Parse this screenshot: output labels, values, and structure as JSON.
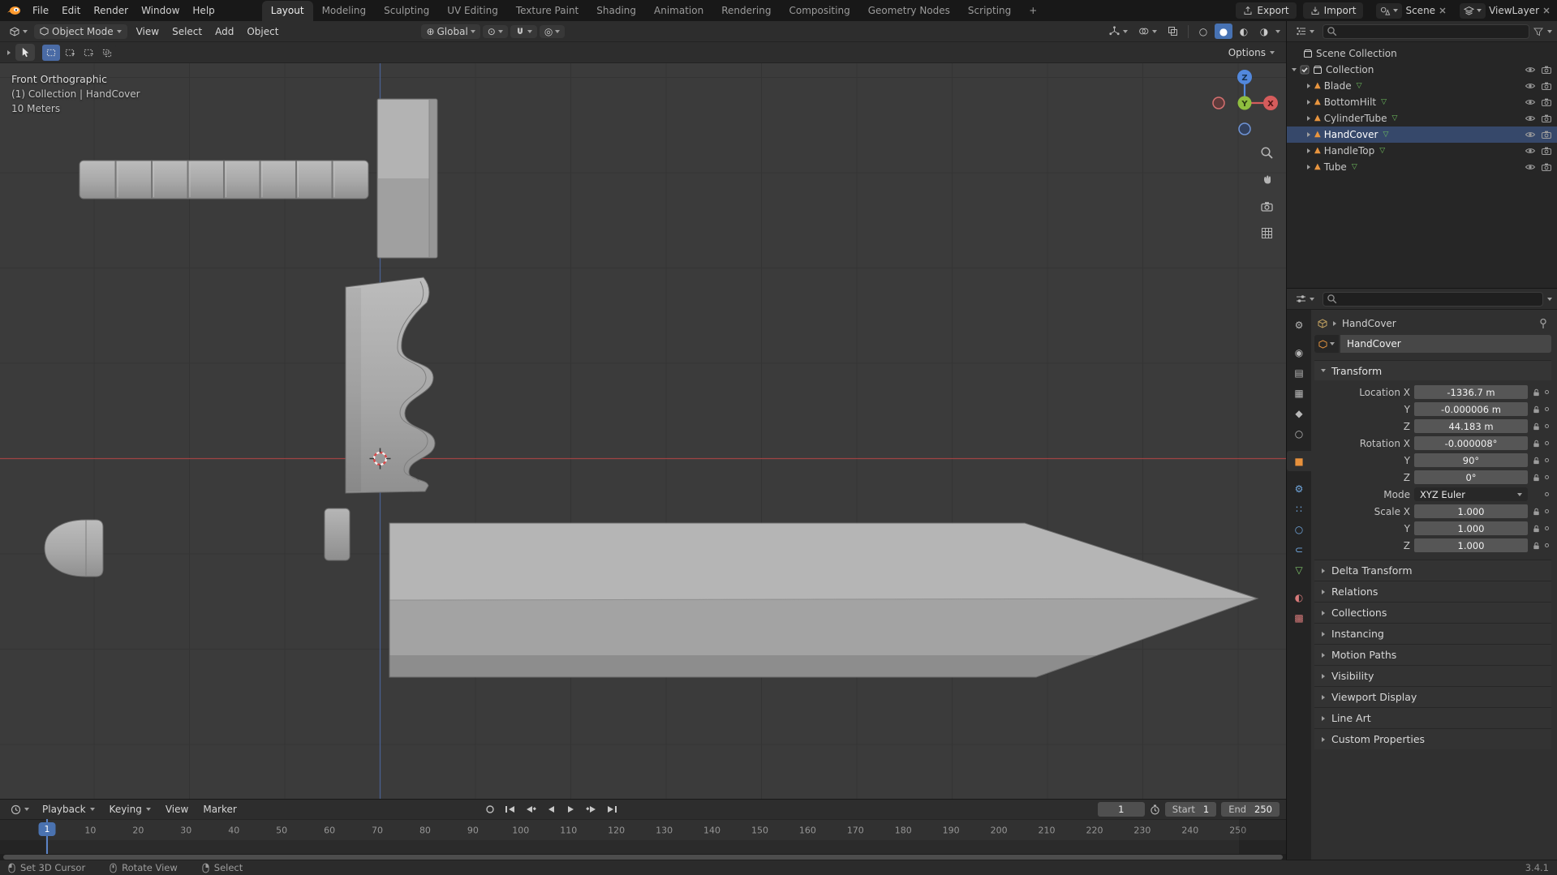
{
  "icons": {
    "mesh": "▲",
    "mesh_data": "▽",
    "wireframe": "○",
    "solid": "●",
    "material_preview": "◐",
    "rendered": "◑",
    "proportional": "◎",
    "pivot": "⊙",
    "orientation": "⊕"
  },
  "topbar": {
    "menus": [
      "File",
      "Edit",
      "Render",
      "Window",
      "Help"
    ],
    "tabs": [
      {
        "label": "Layout",
        "active": true
      },
      {
        "label": "Modeling"
      },
      {
        "label": "Sculpting"
      },
      {
        "label": "UV Editing"
      },
      {
        "label": "Texture Paint"
      },
      {
        "label": "Shading"
      },
      {
        "label": "Animation"
      },
      {
        "label": "Rendering"
      },
      {
        "label": "Compositing"
      },
      {
        "label": "Geometry Nodes"
      },
      {
        "label": "Scripting"
      }
    ],
    "add_tab_label": "+",
    "export_label": "Export",
    "import_label": "Import",
    "scene_name": "Scene",
    "viewlayer_name": "ViewLayer"
  },
  "viewport_header": {
    "mode_label": "Object Mode",
    "menus": [
      "View",
      "Select",
      "Add",
      "Object"
    ],
    "orientation_label": "Global",
    "options_label": "Options"
  },
  "viewport": {
    "overlay": {
      "line1": "Front Orthographic",
      "line2": "(1) Collection | HandCover",
      "line3": "10 Meters"
    },
    "gizmo": {
      "x": "X",
      "y": "Y",
      "z": "Z"
    }
  },
  "outliner": {
    "root": "Scene Collection",
    "collection": "Collection",
    "items": [
      {
        "name": "Blade"
      },
      {
        "name": "BottomHilt"
      },
      {
        "name": "CylinderTube"
      },
      {
        "name": "HandCover",
        "selected": true
      },
      {
        "name": "HandleTop"
      },
      {
        "name": "Tube"
      }
    ]
  },
  "properties": {
    "breadcrumb_object": "HandCover",
    "object_name": "HandCover",
    "transform_title": "Transform",
    "transform_rows": [
      {
        "label": "Location X",
        "value": "-1336.7 m"
      },
      {
        "label": "Y",
        "value": "-0.000006 m"
      },
      {
        "label": "Z",
        "value": "44.183 m"
      },
      {
        "label": "Rotation X",
        "value": "-0.000008°"
      },
      {
        "label": "Y",
        "value": "90°"
      },
      {
        "label": "Z",
        "value": "0°"
      }
    ],
    "mode_label": "Mode",
    "mode_value": "XYZ Euler",
    "scale_rows": [
      {
        "label": "Scale X",
        "value": "1.000"
      },
      {
        "label": "Y",
        "value": "1.000"
      },
      {
        "label": "Z",
        "value": "1.000"
      }
    ],
    "panels": [
      "Delta Transform",
      "Relations",
      "Collections",
      "Instancing",
      "Motion Paths",
      "Visibility",
      "Viewport Display",
      "Line Art",
      "Custom Properties"
    ],
    "tabs": [
      {
        "id": "tool-tab",
        "glyph": "⚙",
        "color": "#b8b8b8"
      },
      {
        "id": "render-tab",
        "glyph": "◉",
        "color": "#b8b8b8",
        "gap": true
      },
      {
        "id": "output-tab",
        "glyph": "▤",
        "color": "#b8b8b8"
      },
      {
        "id": "viewlayer-tab",
        "glyph": "▦",
        "color": "#b8b8b8"
      },
      {
        "id": "scene-tab",
        "glyph": "◆",
        "color": "#b8b8b8"
      },
      {
        "id": "world-tab",
        "glyph": "○",
        "color": "#b8b8b8"
      },
      {
        "id": "object-tab",
        "glyph": "■",
        "color": "#e8913c",
        "active": true,
        "gap": true
      },
      {
        "id": "modifiers-tab",
        "glyph": "⚙",
        "color": "#71a8e0",
        "gap": true
      },
      {
        "id": "particles-tab",
        "glyph": "∷",
        "color": "#71a8e0"
      },
      {
        "id": "physics-tab",
        "glyph": "○",
        "color": "#71a8e0"
      },
      {
        "id": "constraints-tab",
        "glyph": "⊂",
        "color": "#71a8e0"
      },
      {
        "id": "data-tab",
        "glyph": "▽",
        "color": "#7ec26a"
      },
      {
        "id": "material-tab",
        "glyph": "◐",
        "color": "#d87a7a",
        "gap": true
      },
      {
        "id": "texture-tab",
        "glyph": "▩",
        "color": "#d87a7a"
      }
    ]
  },
  "timeline": {
    "menus": [
      "Playback",
      "Keying",
      "View",
      "Marker"
    ],
    "current_frame": "1",
    "start_label": "Start",
    "start_value": "1",
    "end_label": "End",
    "end_value": "250",
    "ruler_ticks": [
      10,
      20,
      30,
      40,
      50,
      60,
      70,
      80,
      90,
      100,
      110,
      120,
      130,
      140,
      150,
      160,
      170,
      180,
      190,
      200,
      210,
      220,
      230,
      240,
      250
    ]
  },
  "statusbar": {
    "items": [
      "Set 3D Cursor",
      "Rotate View",
      "Select"
    ],
    "version": "3.4.1"
  }
}
